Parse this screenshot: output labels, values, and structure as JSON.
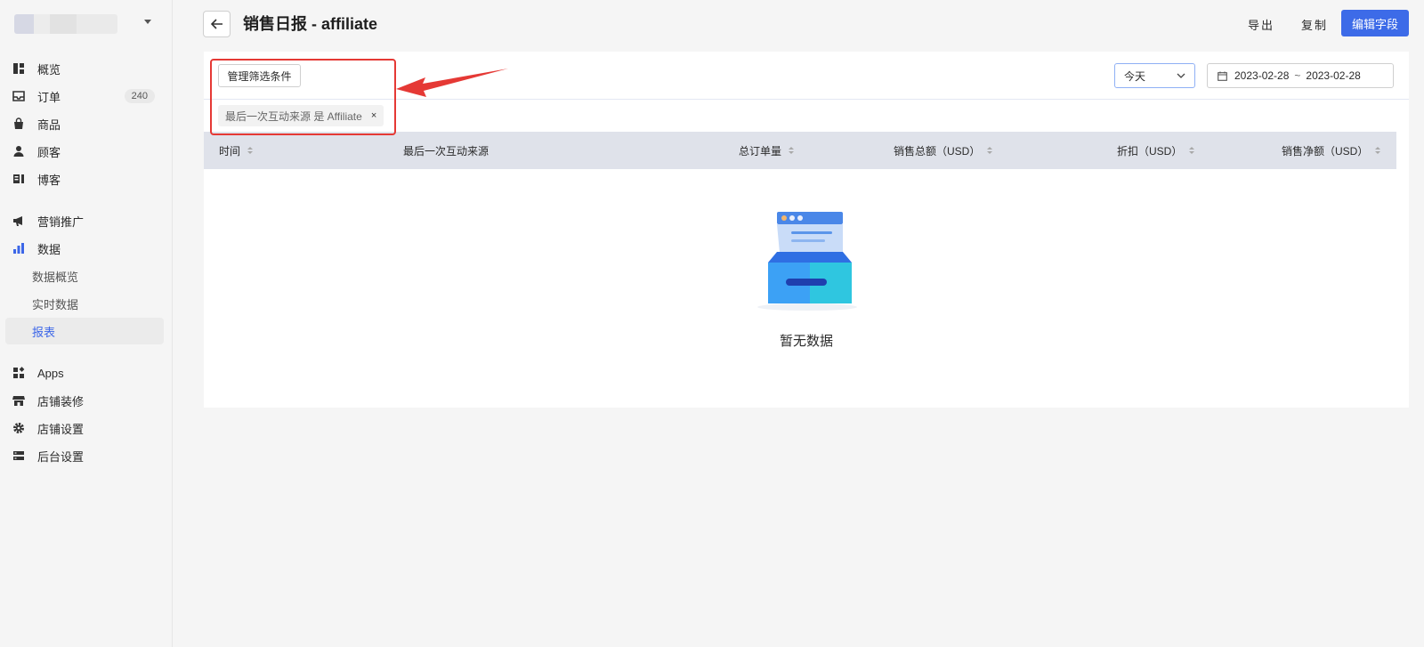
{
  "sidebar": {
    "nav": [
      {
        "label": "概览",
        "icon": "dashboard-icon"
      },
      {
        "label": "订单",
        "icon": "inbox-icon",
        "badge": "240"
      },
      {
        "label": "商品",
        "icon": "bag-icon"
      },
      {
        "label": "顾客",
        "icon": "person-icon"
      },
      {
        "label": "博客",
        "icon": "blog-icon"
      },
      {
        "label": "营销推广",
        "icon": "megaphone-icon"
      },
      {
        "label": "数据",
        "icon": "bar-chart-icon"
      },
      {
        "label": "Apps",
        "icon": "apps-icon"
      },
      {
        "label": "店铺装修",
        "icon": "storefront-icon"
      },
      {
        "label": "店铺设置",
        "icon": "gear-icon"
      },
      {
        "label": "后台设置",
        "icon": "server-icon"
      }
    ],
    "data_sub": [
      {
        "label": "数据概览"
      },
      {
        "label": "实时数据"
      },
      {
        "label": "报表",
        "active": true
      }
    ]
  },
  "header": {
    "title": "销售日报 - affiliate",
    "export_label": "导出",
    "copy_label": "复制",
    "edit_fields_label": "编辑字段"
  },
  "filters": {
    "manage_label": "管理筛选条件",
    "period_selected": "今天",
    "date_start": "2023-02-28",
    "date_sep": "~",
    "date_end": "2023-02-28",
    "tag_label": "最后一次互动来源 是 Affiliate",
    "tag_remove": "×"
  },
  "table": {
    "columns": [
      {
        "label": "时间",
        "sortable": true
      },
      {
        "label": "最后一次互动来源",
        "sortable": false
      },
      {
        "label": "总订单量",
        "sortable": true
      },
      {
        "label": "销售总额（USD）",
        "sortable": true
      },
      {
        "label": "折扣（USD）",
        "sortable": true
      },
      {
        "label": "销售净额（USD）",
        "sortable": true
      }
    ],
    "rows": [],
    "empty_text": "暂无数据"
  },
  "colors": {
    "primary": "#3d6be8",
    "annotation": "#e53935",
    "active_nav": "#3c66e8"
  }
}
